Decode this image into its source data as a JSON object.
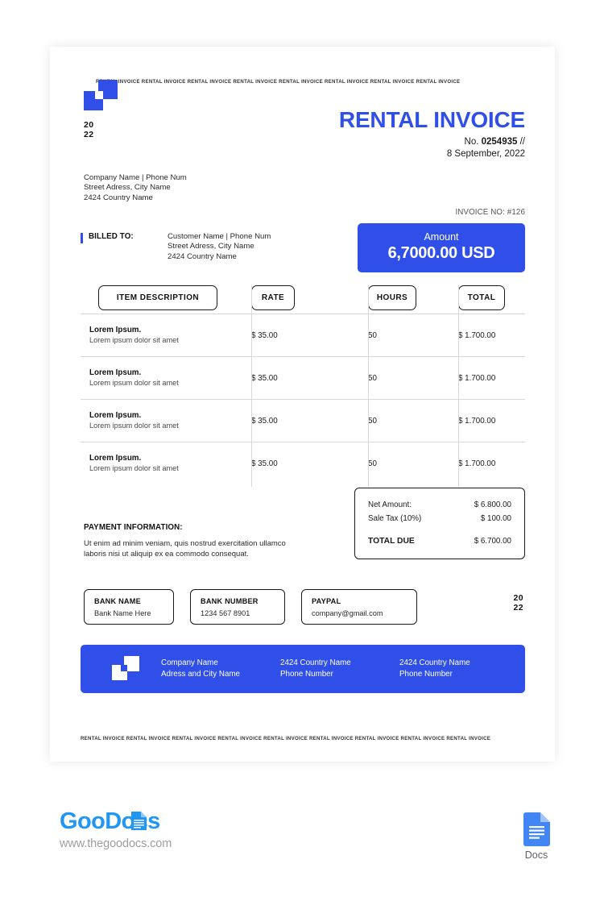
{
  "brand_colors": {
    "blue": "#2f4fe8",
    "goodocs_blue": "#2196f3",
    "docs_blue": "#4285f4"
  },
  "marquee": {
    "top": "RENTAL INVOICE RENTAL INVOICE RENTAL INVOICE RENTAL INVOICE RENTAL INVOICE RENTAL INVOICE RENTAL INVOICE RENTAL INVOICE",
    "bottom": "RENTAL INVOICE RENTAL INVOICE RENTAL INVOICE RENTAL INVOICE RENTAL INVOICE RENTAL INVOICE RENTAL INVOICE RENTAL INVOICE RENTAL INVOICE"
  },
  "header": {
    "year_line1": "20",
    "year_line2": "22",
    "title": "RENTAL INVOICE",
    "number_prefix": "No.",
    "number": "0254935",
    "number_suffix": "//",
    "date": "8 September, 2022"
  },
  "company": {
    "line1": "Company Name | Phone Num",
    "line2": "Street Adress, City Name",
    "line3": "2424 Country Name"
  },
  "billed_to": {
    "label": "BILLED TO:",
    "line1": "Customer Name | Phone Num",
    "line2": "Street Adress, City Name",
    "line3": "2424 Country Name"
  },
  "invoice_no": {
    "label": "INVOICE NO:",
    "value": "#126"
  },
  "amount": {
    "label": "Amount",
    "value": "6,7000.00 USD"
  },
  "table": {
    "headers": {
      "description": "ITEM DESCRIPTION",
      "rate": "RATE",
      "hours": "HOURS",
      "total": "TOTAL"
    },
    "rows": [
      {
        "name": "Lorem Ipsum.",
        "sub": "Lorem ipsum dolor sit amet",
        "rate": "$ 35.00",
        "hours": "50",
        "total": "$ 1.700.00"
      },
      {
        "name": "Lorem Ipsum.",
        "sub": "Lorem ipsum dolor sit amet",
        "rate": "$ 35.00",
        "hours": "50",
        "total": "$ 1.700.00"
      },
      {
        "name": "Lorem Ipsum.",
        "sub": "Lorem ipsum dolor sit amet",
        "rate": "$ 35.00",
        "hours": "50",
        "total": "$ 1.700.00"
      },
      {
        "name": "Lorem Ipsum.",
        "sub": "Lorem ipsum dolor sit amet",
        "rate": "$ 35.00",
        "hours": "50",
        "total": "$ 1.700.00"
      }
    ]
  },
  "totals": {
    "net_label": "Net Amount:",
    "net_value": "$ 6.800.00",
    "tax_label": "Sale Tax (10%)",
    "tax_value": "$ 100.00",
    "due_label": "TOTAL DUE",
    "due_value": "$ 6.700.00"
  },
  "payment": {
    "title": "PAYMENT INFORMATION:",
    "text": "Ut enim ad minim veniam, quis nostrud exercitation ullamco laboris nisi ut aliquip ex ea commodo consequat."
  },
  "banks": [
    {
      "label": "BANK NAME",
      "value": "Bank Name Here"
    },
    {
      "label": "BANK NUMBER",
      "value": "1234 567 8901"
    },
    {
      "label": "PAYPAL",
      "value": "company@gmail.com"
    }
  ],
  "year_right": {
    "line1": "20",
    "line2": "22"
  },
  "footer": {
    "col1_line1": "Company Name",
    "col1_line2": "Adress and City Name",
    "col2_line1": "2424 Country Name",
    "col2_line2": "Phone Number",
    "col3_line1": "2424 Country Name",
    "col3_line2": "Phone Number"
  },
  "goodocs": {
    "name_part1": "Goo",
    "name_part2": "Docs",
    "url": "www.thegoodocs.com",
    "docs_caption": "Docs"
  }
}
